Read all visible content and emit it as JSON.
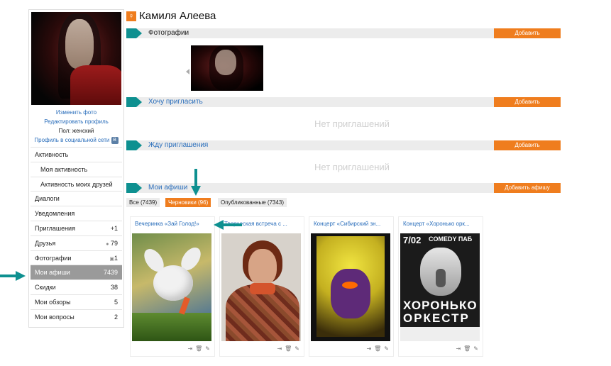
{
  "profile": {
    "name": "Камиля Алеева",
    "links": [
      "Изменить фото",
      "Редактировать профиль"
    ],
    "gender": "Пол: женский",
    "social_link": "Профиль в социальной сети",
    "social_badge": "В"
  },
  "menu": [
    {
      "label": "Активность",
      "count": "",
      "sub": false
    },
    {
      "label": "Моя активность",
      "count": "",
      "sub": true
    },
    {
      "label": "Активность моих друзей",
      "count": "",
      "sub": true
    },
    {
      "label": "Диалоги",
      "count": "",
      "sub": false
    },
    {
      "label": "Уведомления",
      "count": "",
      "sub": false
    },
    {
      "label": "Приглашения",
      "count": "+1",
      "sub": false
    },
    {
      "label": "Друзья",
      "count": "79",
      "sub": false
    },
    {
      "label": "Фотографии",
      "count": "1",
      "sub": false
    },
    {
      "label": "Мои афиши",
      "count": "7439",
      "sub": false,
      "active": true
    },
    {
      "label": "Скидки",
      "count": "38",
      "sub": false
    },
    {
      "label": "Мои обзоры",
      "count": "5",
      "sub": false
    },
    {
      "label": "Мои вопросы",
      "count": "2",
      "sub": false
    }
  ],
  "sections": {
    "photos": {
      "label": "Фотографии",
      "button": "Добавить"
    },
    "want_invite": {
      "label": "Хочу пригласить",
      "button": "Добавить",
      "empty": "Нет приглашений"
    },
    "wait_invite": {
      "label": "Жду приглашения",
      "button": "Добавить",
      "empty": "Нет приглашений"
    },
    "my_posters": {
      "label": "Мои афиши",
      "button": "Добавить афишу"
    }
  },
  "filters": [
    "Все (7439)",
    "Черновики (96)",
    "Опубликованные (7343)"
  ],
  "cards": [
    {
      "title": "Вечеринка «Зай Голод!»"
    },
    {
      "title": "Творческая встреча с ..."
    },
    {
      "title": "Концерт «Сибирский зн..."
    },
    {
      "title": "Концерт «Хоронько орк..."
    }
  ],
  "poster4": {
    "date": "7/02",
    "club": "COMEDY ПАБ",
    "band1": "ХОРОНЬКО",
    "band2": "ОРКЕСТР"
  },
  "colors": {
    "accent": "#ef7d1e",
    "teal": "#0e9090",
    "link": "#2a6ebb"
  }
}
